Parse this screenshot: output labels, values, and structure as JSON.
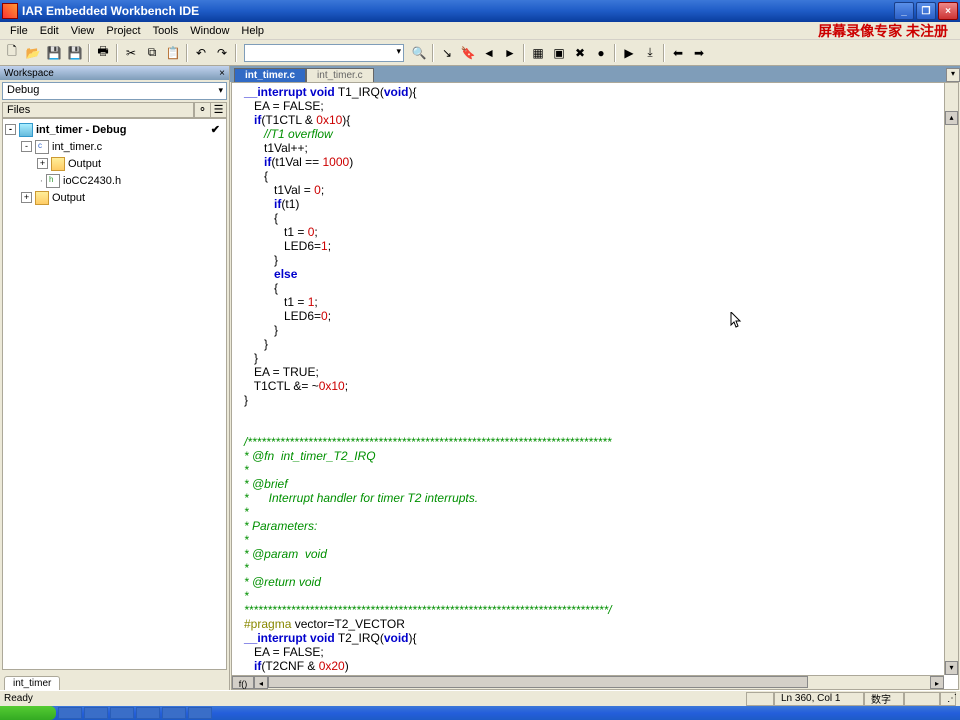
{
  "window": {
    "title": "IAR Embedded Workbench IDE"
  },
  "menu": {
    "file": "File",
    "edit": "Edit",
    "view": "View",
    "project": "Project",
    "tools": "Tools",
    "window": "Window",
    "help": "Help"
  },
  "watermark": "屏幕录像专家 未注册",
  "workspace": {
    "title": "Workspace",
    "config": "Debug",
    "col_files": "Files",
    "root": "int_timer - Debug",
    "items": [
      {
        "label": "int_timer.c",
        "icon": "c",
        "depth": 1,
        "exp": "-"
      },
      {
        "label": "Output",
        "icon": "out",
        "depth": 2,
        "exp": "+"
      },
      {
        "label": "ioCC2430.h",
        "icon": "h",
        "depth": 2,
        "exp": ""
      },
      {
        "label": "Output",
        "icon": "out",
        "depth": 1,
        "exp": "+"
      }
    ],
    "tab": "int_timer"
  },
  "editor": {
    "tabs": [
      {
        "label": "int_timer.c",
        "active": true
      },
      {
        "label": "int_timer.c",
        "active": false
      }
    ],
    "code": "__interrupt void T1_IRQ(void){\n   EA = FALSE;\n   if(T1CTL & 0x10){\n      //T1 overflow\n      t1Val++;\n      if(t1Val == 1000)\n      {\n         t1Val = 0;\n         if(t1)\n         {\n            t1 = 0;\n            LED6=1;\n         }\n         else\n         {\n            t1 = 1;\n            LED6=0;\n         }\n      }\n   }\n   EA = TRUE;\n   T1CTL &= ~0x10;\n}\n\n\n/******************************************************************************\n* @fn  int_timer_T2_IRQ\n*\n* @brief\n*      Interrupt handler for timer T2 interrupts.\n*\n* Parameters:\n*\n* @param  void\n*\n* @return void\n*\n******************************************************************************/\n#pragma vector=T2_VECTOR\n__interrupt void T2_IRQ(void){\n   EA = FALSE;\n   if(T2CNF & 0x20)"
  },
  "status": {
    "ready": "Ready",
    "pos": "Ln 360, Col 1",
    "mode": "数字"
  }
}
